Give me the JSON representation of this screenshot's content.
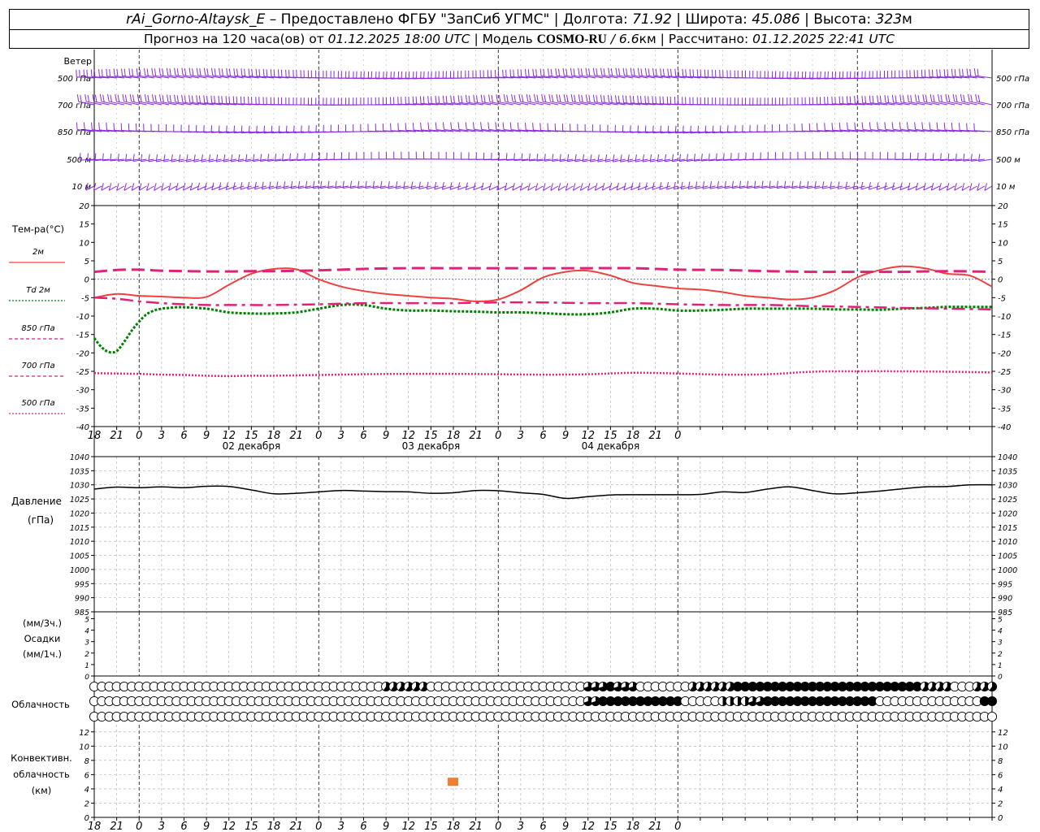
{
  "header": {
    "station": "rAi_Gorno-Altaysk_E",
    "sep1": " – Предоставлено ФГБУ \"ЗапСиб УГМС\" | Долгота: ",
    "lon": "71.92",
    "sep2": " | Широта: ",
    "lat": "45.086",
    "sep3": " | Высота: ",
    "alt": "323",
    "alt_unit": "м",
    "fc_prefix": "Прогноз на 120 часа(ов) от ",
    "fc_time": "01.12.2025 18:00 UTC",
    "model_prefix": "  | Модель ",
    "model": "COSMO-RU",
    "model_res": " / 6.6",
    "model_res_unit": "км",
    "calc_prefix": " | Рассчитано: ",
    "calc_time": "01.12.2025 22:41 UTC"
  },
  "time_axis": {
    "hour_labels": [
      "18",
      "21",
      "0",
      "3",
      "6",
      "9",
      "12",
      "15",
      "18",
      "21",
      "0",
      "3",
      "6",
      "9",
      "12",
      "15",
      "18",
      "21",
      "0",
      "3",
      "6",
      "9",
      "12",
      "15",
      "18",
      "21",
      "0"
    ],
    "day_labels": [
      "02 декабря",
      "03 декабря",
      "04 декабря"
    ]
  },
  "wind_panel": {
    "title": "Ветер",
    "levels": [
      "500 гПа",
      "700 гПа",
      "850 гПа",
      "500 м",
      "10 м"
    ],
    "color": "#8a2be2"
  },
  "temp_panel": {
    "title": "Тем-ра(°С)",
    "y_ticks": [
      20,
      15,
      10,
      5,
      0,
      -5,
      -10,
      -15,
      -20,
      -25,
      -30,
      -35,
      -40
    ],
    "legend": [
      {
        "label": "2м",
        "color": "#ff4040",
        "style": "solid"
      },
      {
        "label_prefix": "Td",
        "label": "2м",
        "color": "#008000",
        "style": "dotted"
      },
      {
        "label": "850 гПа",
        "color": "#e0217a",
        "style": "dashed"
      },
      {
        "label": "700 гПа",
        "color": "#e0217a",
        "style": "dashdot"
      },
      {
        "label": "500 гПа",
        "color": "#e0217a",
        "style": "dotted"
      }
    ]
  },
  "pressure_panel": {
    "title": "Давление",
    "unit": "(гПа)",
    "y_ticks": [
      1040,
      1035,
      1030,
      1025,
      1020,
      1015,
      1010,
      1005,
      1000,
      995,
      990,
      985
    ]
  },
  "precip_panel": {
    "unit1": "(мм/3ч.)",
    "title": "Осадки",
    "unit2": "(мм/1ч.)",
    "y_ticks": [
      5,
      4,
      3,
      2,
      1,
      0
    ]
  },
  "cloud_panel": {
    "title": "Облачность"
  },
  "conv_panel": {
    "title1": "Конвективн.",
    "title2": "облачность",
    "unit": "(км)",
    "y_ticks": [
      12,
      10,
      8,
      6,
      4,
      2,
      0
    ],
    "marker_color": "#f08030"
  },
  "chart_data": {
    "type": "line",
    "x_hours_from_start": "0..120 step 1, start 01.12.2025 18 UTC",
    "series": [
      {
        "name": "2м",
        "x": [
          0,
          3,
          6,
          9,
          12,
          15,
          18,
          21,
          24,
          27,
          30,
          33,
          36,
          39,
          42,
          45,
          48,
          51,
          54,
          57,
          60,
          63,
          66,
          69,
          72,
          75,
          78,
          81,
          84,
          87,
          90,
          93,
          96,
          99,
          102,
          105,
          108,
          111,
          114,
          117,
          120
        ],
        "values": [
          -5,
          -4,
          -4.5,
          -4.7,
          -5,
          -4.8,
          -1.5,
          1.5,
          2.8,
          2.7,
          0,
          -2,
          -3.2,
          -4,
          -4.5,
          -5,
          -5.3,
          -6,
          -5.5,
          -3,
          0.5,
          2,
          2.3,
          1,
          -1,
          -1.8,
          -2.5,
          -2.8,
          -3.5,
          -4.5,
          -5,
          -5.5,
          -5,
          -3,
          0.5,
          2.5,
          3.5,
          3,
          1.5,
          1,
          -2
        ]
      },
      {
        "name": "Td 2м",
        "x": [
          0,
          1,
          2,
          3,
          4,
          5,
          6,
          7,
          8,
          9,
          10,
          11,
          12,
          15,
          18,
          21,
          24,
          27,
          30,
          33,
          36,
          39,
          42,
          45,
          48,
          51,
          54,
          57,
          60,
          63,
          66,
          69,
          72,
          75,
          78,
          81,
          84,
          87,
          90,
          93,
          96,
          99,
          102,
          105,
          108,
          111,
          114,
          117,
          120
        ],
        "values": [
          -16,
          -18.5,
          -19.8,
          -19.5,
          -17,
          -14,
          -11.5,
          -9.5,
          -8.5,
          -8,
          -7.8,
          -7.6,
          -7.6,
          -8,
          -9,
          -9.3,
          -9.3,
          -9,
          -8,
          -7,
          -7,
          -8,
          -8.5,
          -8.5,
          -8.7,
          -8.8,
          -9,
          -9,
          -9.2,
          -9.5,
          -9.5,
          -9,
          -8,
          -8,
          -8.5,
          -8.5,
          -8.3,
          -8,
          -8,
          -8,
          -8,
          -8.2,
          -8.2,
          -8.3,
          -8,
          -7.8,
          -7.5,
          -7.5,
          -7.5
        ]
      },
      {
        "name": "850 гПа",
        "x": [
          0,
          3,
          6,
          9,
          12,
          15,
          18,
          21,
          24,
          30,
          36,
          42,
          48,
          54,
          60,
          66,
          72,
          78,
          84,
          90,
          96,
          102,
          108,
          114,
          120
        ],
        "values": [
          2,
          2.5,
          2.6,
          2.3,
          2.2,
          2.1,
          2.1,
          2.2,
          2.2,
          2.4,
          2.8,
          3,
          3,
          3,
          3,
          3,
          3,
          2.6,
          2.5,
          2.2,
          2,
          2,
          2,
          2.2,
          2
        ]
      },
      {
        "name": "700 гПа",
        "x": [
          0,
          3,
          6,
          9,
          12,
          15,
          18,
          21,
          24,
          30,
          36,
          42,
          48,
          54,
          60,
          66,
          72,
          78,
          84,
          90,
          96,
          102,
          108,
          114,
          120
        ],
        "values": [
          -5,
          -5.3,
          -6,
          -6.5,
          -6.8,
          -7,
          -7,
          -7,
          -7,
          -6.8,
          -6.5,
          -6.5,
          -6.5,
          -6.3,
          -6.3,
          -6.5,
          -6.5,
          -6.8,
          -7,
          -7,
          -7.3,
          -7.5,
          -7.8,
          -8,
          -8.2
        ]
      },
      {
        "name": "500 гПа",
        "x": [
          0,
          3,
          6,
          9,
          12,
          15,
          18,
          21,
          24,
          30,
          36,
          42,
          48,
          54,
          60,
          66,
          72,
          78,
          84,
          90,
          96,
          102,
          108,
          114,
          120
        ],
        "values": [
          -25.5,
          -25.6,
          -25.7,
          -25.9,
          -26,
          -26.2,
          -26.3,
          -26.2,
          -26.2,
          -26,
          -25.8,
          -25.7,
          -25.7,
          -25.8,
          -25.9,
          -25.8,
          -25.4,
          -25.6,
          -25.9,
          -25.8,
          -25.1,
          -25,
          -25,
          -25.1,
          -25.3
        ]
      },
      {
        "name": "Давление",
        "x": [
          0,
          3,
          6,
          9,
          12,
          15,
          18,
          21,
          24,
          27,
          30,
          33,
          36,
          39,
          42,
          45,
          48,
          51,
          54,
          57,
          60,
          63,
          66,
          69,
          72,
          75,
          78,
          81,
          84,
          87,
          90,
          93,
          96,
          99,
          102,
          105,
          108,
          111,
          114,
          117,
          120
        ],
        "values": [
          1028.5,
          1029.2,
          1029,
          1029.3,
          1029,
          1029.5,
          1029.4,
          1028.2,
          1026.8,
          1027,
          1027.5,
          1028,
          1027.8,
          1027.6,
          1027.5,
          1027,
          1027.2,
          1028,
          1027.9,
          1027.2,
          1026.6,
          1025.2,
          1025.8,
          1026.4,
          1026.5,
          1026.5,
          1026.5,
          1026.6,
          1027.5,
          1027.3,
          1028.5,
          1029.3,
          1028,
          1026.8,
          1027.2,
          1027.8,
          1028.6,
          1029.3,
          1029.4,
          1030,
          1030
        ]
      }
    ],
    "convective_cloud": [
      {
        "x_hour": 48,
        "height_km": 5
      }
    ],
    "xlim": [
      0,
      120
    ],
    "temp_ylim": [
      -40,
      20
    ],
    "pressure_ylim": [
      985,
      1040
    ],
    "precip_ylim": [
      0,
      5
    ],
    "conv_ylim": [
      0,
      13
    ]
  }
}
